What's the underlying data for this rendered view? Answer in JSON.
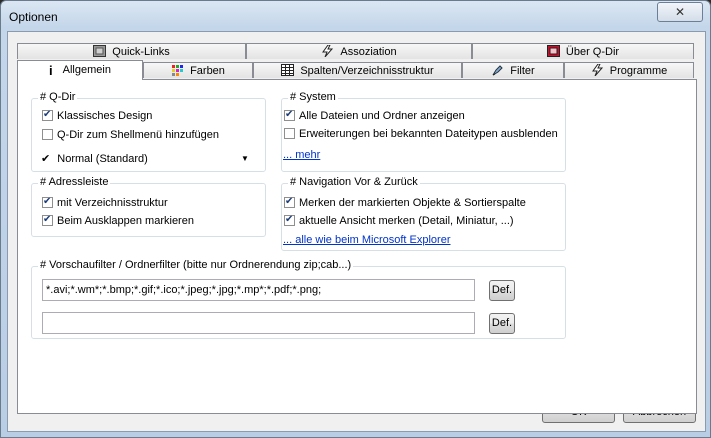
{
  "window": {
    "title": "Optionen",
    "close_glyph": "✕"
  },
  "tabs_row1": [
    {
      "label": "Quick-Links",
      "icon": "quicklinks-icon"
    },
    {
      "label": "Assoziation",
      "icon": "lightning-icon"
    },
    {
      "label": "Über Q-Dir",
      "icon": "qdir-icon"
    }
  ],
  "tabs_row2": [
    {
      "label": "Allgemein",
      "icon": "info-icon",
      "active": true
    },
    {
      "label": "Farben",
      "icon": "colors-icon"
    },
    {
      "label": "Spalten/Verzeichnisstruktur",
      "icon": "columns-icon"
    },
    {
      "label": "Filter",
      "icon": "filter-icon"
    },
    {
      "label": "Programme",
      "icon": "lightning-icon"
    }
  ],
  "qdir": {
    "title": "# Q-Dir",
    "classic": {
      "label": "Klassisches Design",
      "checked": true
    },
    "shellmenu": {
      "label": "Q-Dir zum Shellmenü hinzufügen",
      "checked": false
    },
    "mode": {
      "check": "✔",
      "value": "Normal (Standard)"
    }
  },
  "system": {
    "title": "# System",
    "show_all": {
      "label": "Alle Dateien und Ordner anzeigen",
      "checked": true
    },
    "hide_ext": {
      "label": "Erweiterungen bei bekannten Dateitypen ausblenden",
      "checked": false
    },
    "more_link": "... mehr"
  },
  "address": {
    "title": "# Adressleiste",
    "tree": {
      "label": "mit Verzeichnisstruktur",
      "checked": true
    },
    "mark": {
      "label": "Beim Ausklappen markieren",
      "checked": true
    }
  },
  "navigation": {
    "title": "# Navigation Vor & Zurück",
    "remember_sel": {
      "label": "Merken der markierten Objekte & Sortierspalte",
      "checked": true
    },
    "remember_view": {
      "label": "aktuelle Ansicht merken (Detail, Miniatur, ...)",
      "checked": true
    },
    "explorer_link": "... alle wie beim Microsoft Explorer"
  },
  "preview": {
    "title": "# Vorschaufilter / Ordnerfilter (bitte nur Ordnerendung zip;cab...)",
    "filter1": "*.avi;*.wm*;*.bmp;*.gif;*.ico;*.jpeg;*.jpg;*.mp*;*.pdf;*.png;",
    "filter2": "",
    "def_label": "Def."
  },
  "footer": {
    "ok": "OK",
    "cancel": "Abbrechen"
  },
  "colors": {
    "link": "#0033cc",
    "window_frame": "#b9cde4",
    "client_bg": "#f0f0f0",
    "group_border": "#d5dfe5"
  }
}
